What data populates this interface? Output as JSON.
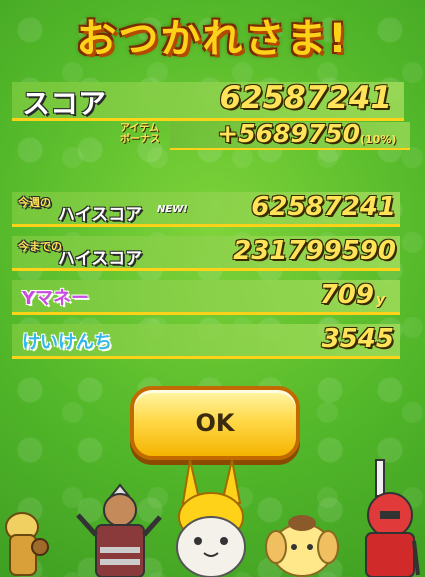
{
  "title": "おつかれさま!",
  "score": {
    "label": "スコア",
    "value": "62587241",
    "bonus_label_top": "アイテム",
    "bonus_label_bottom": "ボーナス",
    "bonus_value": "+5689750",
    "bonus_pct": "(10%)"
  },
  "weekly_high": {
    "label_small": "今週の",
    "label": "ハイスコア",
    "badge": "NEW!",
    "value": "62587241"
  },
  "alltime_high": {
    "label_small": "今までの",
    "label": "ハイスコア",
    "value": "231799590"
  },
  "ymoney": {
    "label": "Yマネー",
    "value": "709",
    "unit": "y"
  },
  "exp": {
    "label": "けいけんち",
    "value": "3545"
  },
  "ok_button": {
    "label": "OK"
  },
  "colors": {
    "background": "#53b82a",
    "title_fill": "#ffd21a",
    "value_fill": "#ffe45a",
    "ymoney_label": "#c94be0",
    "exp_label": "#35b8f0",
    "button": "#ffd94a"
  }
}
